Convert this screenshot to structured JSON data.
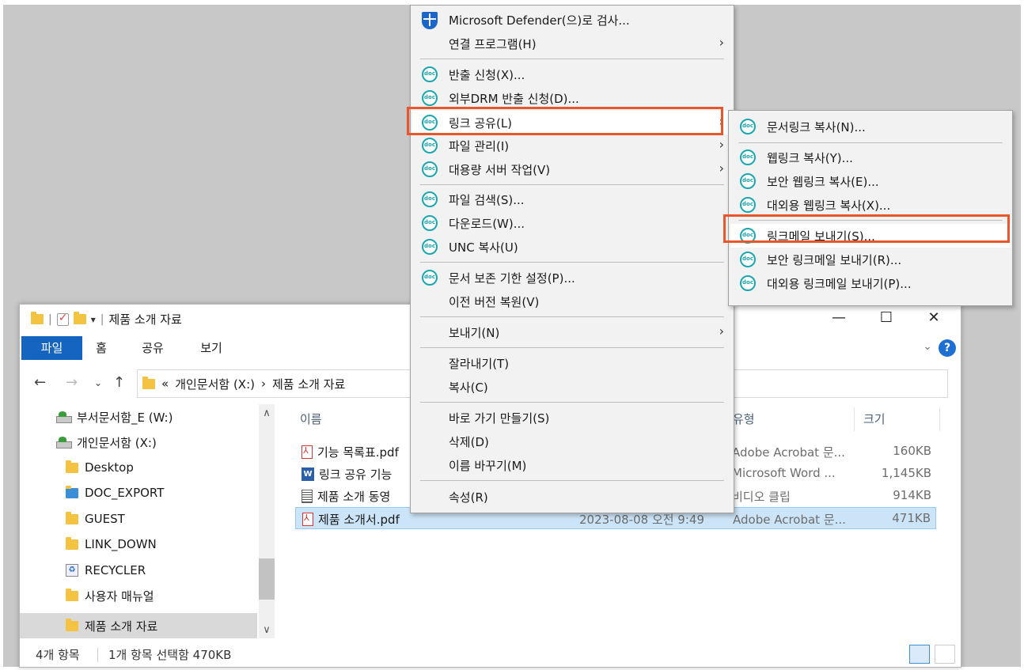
{
  "explorer": {
    "title": "제품 소개 자료",
    "window_controls": {
      "minimize": "—",
      "maximize": "☐",
      "close": "✕"
    },
    "ribbon_tabs": [
      "파일",
      "홈",
      "공유",
      "보기"
    ],
    "help": "?",
    "address": {
      "prefix": "«",
      "drive": "개인문서함 (X:)",
      "separator": "›",
      "folder": "제품 소개 자료"
    },
    "nav_items": [
      {
        "label": "부서문서함_E (W:)",
        "icon": "network-drive-icon"
      },
      {
        "label": "개인문서함 (X:)",
        "icon": "network-drive-icon"
      },
      {
        "label": "Desktop",
        "icon": "folder-icon"
      },
      {
        "label": "DOC_EXPORT",
        "icon": "shared-folder-icon"
      },
      {
        "label": "GUEST",
        "icon": "folder-icon"
      },
      {
        "label": "LINK_DOWN",
        "icon": "folder-icon"
      },
      {
        "label": "RECYCLER",
        "icon": "recycle-icon"
      },
      {
        "label": "사용자 매뉴얼",
        "icon": "folder-icon"
      },
      {
        "label": "제품 소개 자료",
        "icon": "folder-icon"
      }
    ],
    "columns": {
      "name": "이름",
      "type": "유형",
      "size": "크기"
    },
    "files": [
      {
        "name": "기능 목록표.pdf",
        "date": "",
        "type": "Adobe Acrobat 문...",
        "size": "160KB",
        "icon": "pdf-icon"
      },
      {
        "name": "링크 공유 기능",
        "date": "",
        "type": "Microsoft Word ...",
        "size": "1,145KB",
        "icon": "word-icon"
      },
      {
        "name": "제품 소개 동영",
        "date": "",
        "type": "비디오 클립",
        "size": "914KB",
        "icon": "video-icon"
      },
      {
        "name": "제품 소개서.pdf",
        "date": "2023-08-08 오전 9:49",
        "type": "Adobe Acrobat 문...",
        "size": "471KB",
        "icon": "pdf-icon"
      }
    ],
    "status": {
      "count": "4개 항목",
      "selected": "1개 항목 선택함 470KB"
    }
  },
  "context_menu": {
    "items": [
      {
        "label": "Microsoft Defender(으)로 검사...",
        "icon": "defender-shield-icon"
      },
      {
        "label": "연결 프로그램(H)",
        "submenu": true
      },
      {
        "label": "반출 신청(X)...",
        "icon": "doc-icon"
      },
      {
        "label": "외부DRM 반출 신청(D)...",
        "icon": "doc-icon"
      },
      {
        "label": "링크 공유(L)",
        "icon": "doc-icon",
        "submenu": true,
        "highlighted": true
      },
      {
        "label": "파일 관리(I)",
        "icon": "doc-icon",
        "submenu": true
      },
      {
        "label": "대용량 서버 작업(V)",
        "icon": "doc-icon",
        "submenu": true
      },
      {
        "label": "파일 검색(S)...",
        "icon": "doc-icon"
      },
      {
        "label": "다운로드(W)...",
        "icon": "doc-icon"
      },
      {
        "label": "UNC 복사(U)",
        "icon": "doc-icon"
      },
      {
        "label": "문서 보존 기한 설정(P)...",
        "icon": "doc-icon"
      },
      {
        "label": "이전 버전 복원(V)"
      },
      {
        "label": "보내기(N)",
        "submenu": true
      },
      {
        "label": "잘라내기(T)"
      },
      {
        "label": "복사(C)"
      },
      {
        "label": "바로 가기 만들기(S)"
      },
      {
        "label": "삭제(D)"
      },
      {
        "label": "이름 바꾸기(M)"
      },
      {
        "label": "속성(R)"
      }
    ]
  },
  "submenu": {
    "items": [
      {
        "label": "문서링크 복사(N)...",
        "icon": "doc-icon"
      },
      {
        "label": "웹링크 복사(Y)...",
        "icon": "doc-icon"
      },
      {
        "label": "보안 웹링크 복사(E)...",
        "icon": "doc-icon"
      },
      {
        "label": "대외용 웹링크 복사(X)...",
        "icon": "doc-icon"
      },
      {
        "label": "링크메일 보내기(S)...",
        "icon": "doc-icon",
        "highlighted": true
      },
      {
        "label": "보안 링크메일 보내기(R)...",
        "icon": "doc-icon"
      },
      {
        "label": "대외용 링크메일 보내기(P)...",
        "icon": "doc-icon"
      }
    ]
  },
  "colors": {
    "highlight_border": "#e8562a",
    "file_tab": "#1565c0",
    "selection": "#cce4f7",
    "doc_icon": "#1aa6b4"
  }
}
